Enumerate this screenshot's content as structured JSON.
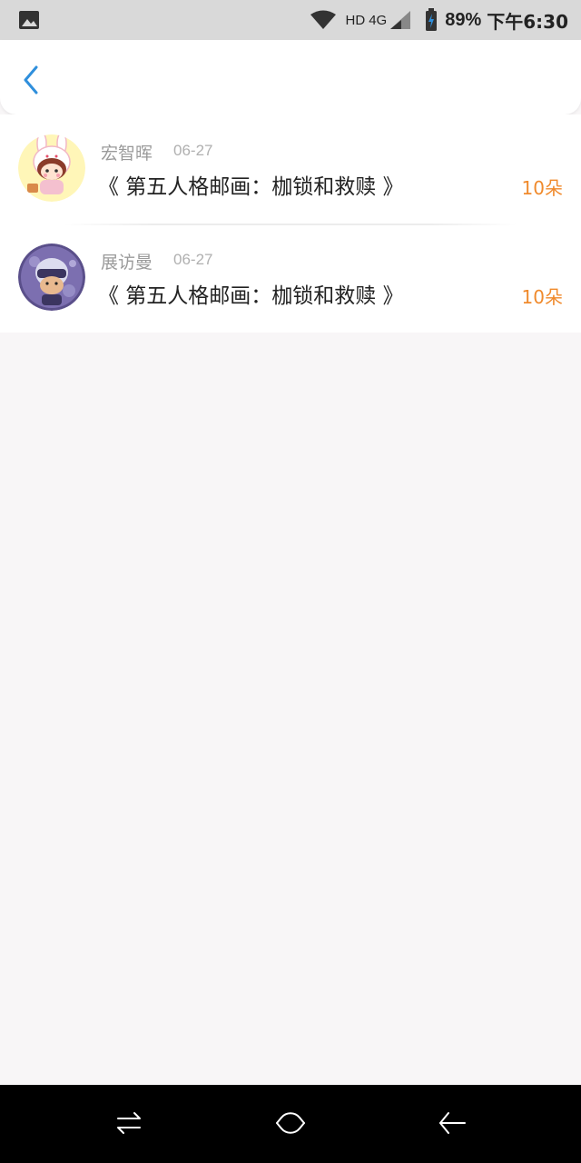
{
  "status_bar": {
    "hd": "HD",
    "network": "4G",
    "battery": "89%",
    "time": "下午6:30",
    "icons": [
      "image-icon",
      "wifi-icon",
      "signal-icon",
      "battery-charging-icon"
    ]
  },
  "header": {
    "back_icon": "chevron-left-icon",
    "accent_color": "#2f8fdc"
  },
  "list": {
    "items": [
      {
        "username": "宏智晖",
        "date": "06-27",
        "title": "《 第五人格邮画：枷锁和救赎 》",
        "flowers": "10朵",
        "avatar": "bunny-girl-avatar"
      },
      {
        "username": "展访曼",
        "date": "06-27",
        "title": "《 第五人格邮画：枷锁和救赎 》",
        "flowers": "10朵",
        "avatar": "masked-character-avatar"
      }
    ],
    "flowers_color": "#f08a2c"
  },
  "nav_bar": {
    "icons": [
      "recent-apps-icon",
      "home-icon",
      "back-icon"
    ]
  }
}
